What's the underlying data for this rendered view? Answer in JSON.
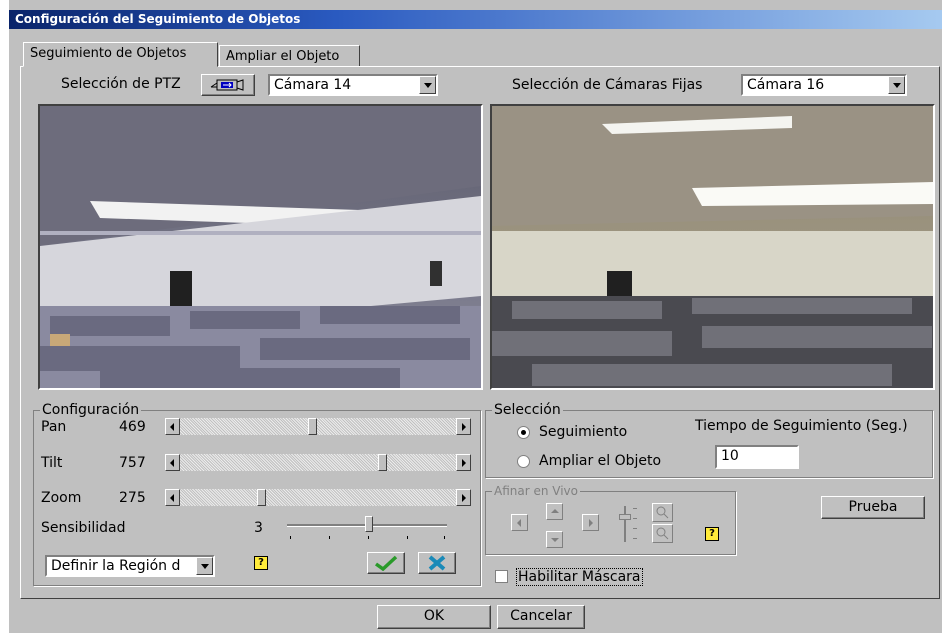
{
  "title": "Configuración del Seguimiento de Objetos",
  "tabs": [
    {
      "label": "Seguimiento de Objetos",
      "active": true
    },
    {
      "label": "Ampliar el Objeto",
      "active": false
    }
  ],
  "ptz": {
    "label": "Selección de PTZ",
    "camera": "Cámara 14"
  },
  "fixed": {
    "label": "Selección de Cámaras Fijas",
    "camera": "Cámara 16"
  },
  "config": {
    "legend": "Configuración",
    "pan": {
      "label": "Pan",
      "value": "469"
    },
    "tilt": {
      "label": "Tilt",
      "value": "757"
    },
    "zoom": {
      "label": "Zoom",
      "value": "275"
    },
    "sensitivity": {
      "label": "Sensibilidad",
      "value": "3"
    },
    "region": "Definir la Región d"
  },
  "selection": {
    "legend": "Selección",
    "tracking": "Seguimiento",
    "zoom_object": "Ampliar el Objeto",
    "time_label": "Tiempo de Seguimiento (Seg.)",
    "time_value": "10"
  },
  "live": {
    "legend": "Afinar en Vivo"
  },
  "test_button": "Prueba",
  "mask_label": "Habilitar Máscara",
  "ok": "OK",
  "cancel": "Cancelar",
  "colors": {
    "title_start": "#0a246a",
    "title_end": "#a6caf0",
    "dialog": "#c0c0c0",
    "help": "#ffeb3b"
  }
}
